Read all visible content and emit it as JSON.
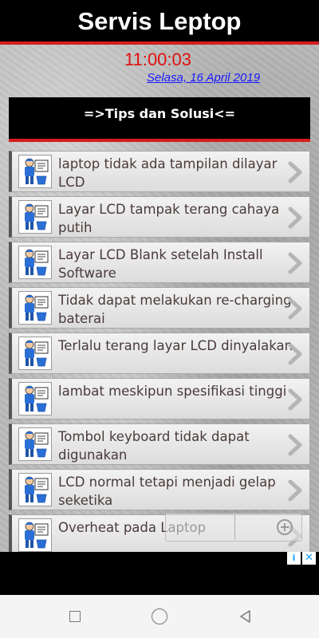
{
  "app": {
    "title": "Servis Leptop"
  },
  "clock": {
    "time": "11:00:03",
    "date": "Selasa, 16 April 2019"
  },
  "section": {
    "label": "=>Tips dan Solusi<="
  },
  "items": [
    {
      "label": "laptop tidak ada tampilan dilayar LCD"
    },
    {
      "label": "Layar LCD tampak terang cahaya putih"
    },
    {
      "label": "Layar LCD Blank setelah Install Software"
    },
    {
      "label": "Tidak dapat melakukan re-charging baterai"
    },
    {
      "label": "Terlalu terang layar LCD dinyalakan"
    },
    {
      "label": "lambat meskipun spesifikasi tinggi"
    },
    {
      "label": "Tombol keyboard tidak dapat digunakan"
    },
    {
      "label": "LCD normal tetapi menjadi gelap seketika"
    },
    {
      "label": "Overheat pada Laptop"
    }
  ],
  "icons": {
    "item_thumbnail": "technician-icon",
    "item_arrow": "chevron-right-icon",
    "zoom": "zoom-in-icon",
    "ad_info": "adchoices-icon",
    "ad_close": "close-icon"
  },
  "ad": {
    "info_glyph": "i",
    "close_glyph": "✕"
  },
  "colors": {
    "appbar": "#000000",
    "accent": "#d61e1e",
    "clock": "#e01010",
    "date": "#1a1aff"
  }
}
